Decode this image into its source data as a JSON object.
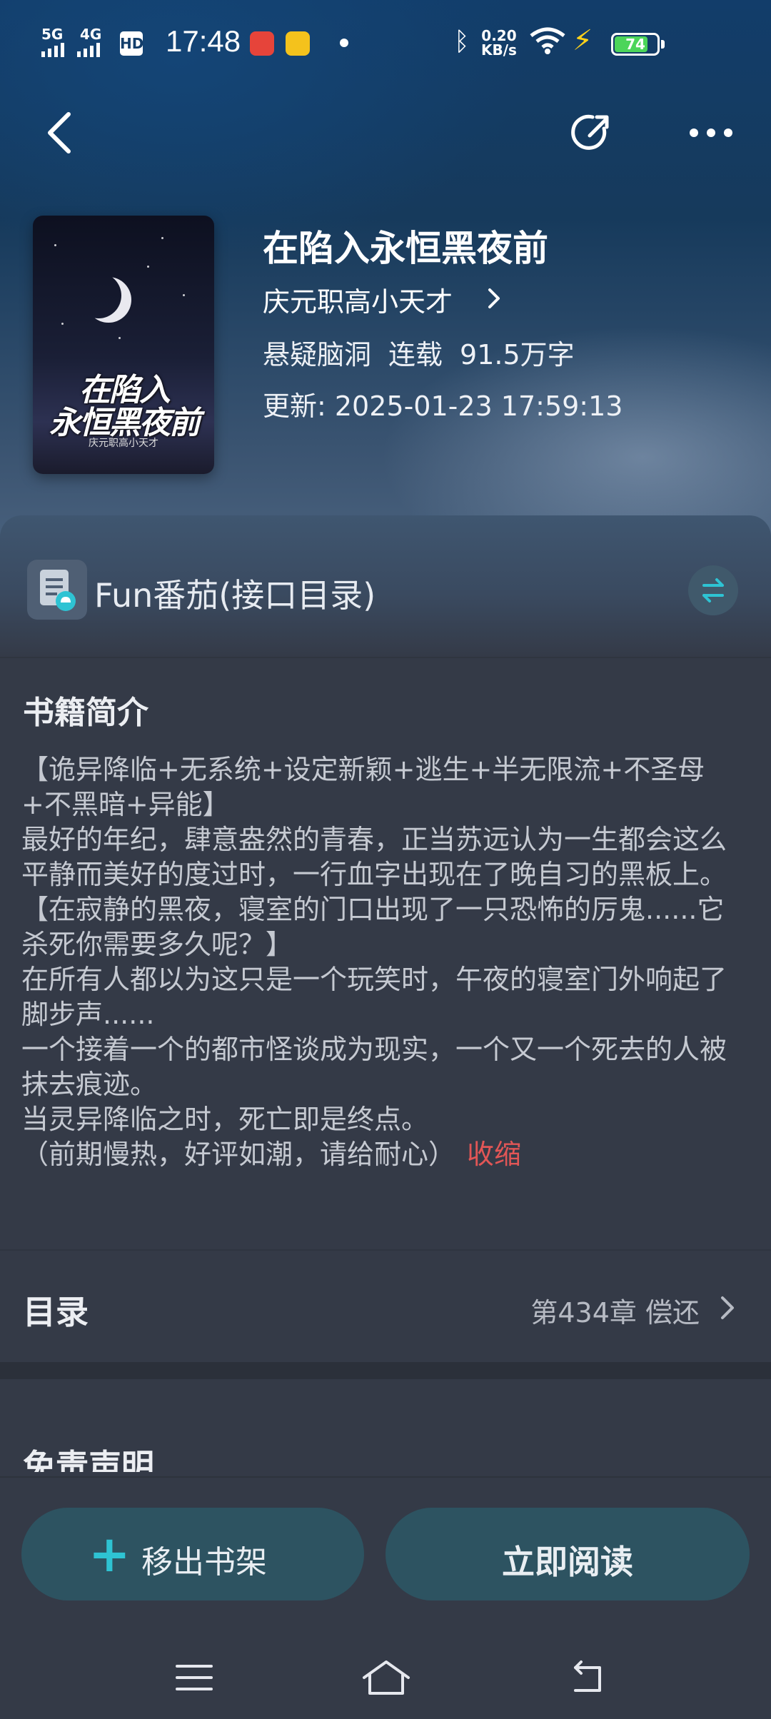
{
  "status_bar": {
    "signal1": "5G",
    "signal2": "4G",
    "hd": "HD",
    "time": "17:48",
    "net_speed_value": "0.20",
    "net_speed_unit": "KB/s",
    "battery": "74",
    "battery_level_percent": 74
  },
  "book": {
    "title": "在陷入永恒黑夜前",
    "author": "庆元职高小天才",
    "category": "悬疑脑洞",
    "status": "连载",
    "word_count": "91.5万字",
    "update": "更新: 2025-01-23 17:59:13",
    "cover_title_line1": "在陷入",
    "cover_title_line2": "永恒黑夜前",
    "cover_author": "庆元职高小天才"
  },
  "source": {
    "label": "Fun番茄(接口目录)"
  },
  "intro": {
    "heading": "书籍简介",
    "lines": [
      "【诡异降临+无系统+设定新颖+逃生+半无限流+不圣母+不黑暗+异能】",
      "最好的年纪，肆意盎然的青春，正当苏远认为一生都会这么平静而美好的度过时，一行血字出现在了晚自习的黑板上。",
      "【在寂静的黑夜，寝室的门口出现了一只恐怖的厉鬼......它杀死你需要多久呢？】",
      "在所有人都以为这只是一个玩笑时，午夜的寝室门外响起了脚步声......",
      "一个接着一个的都市怪谈成为现实，一个又一个死去的人被抹去痕迹。",
      "当灵异降临之时，死亡即是终点。",
      "（前期慢热，好评如潮，请给耐心）"
    ],
    "collapse": "收缩"
  },
  "toc": {
    "label": "目录",
    "latest": "第434章 偿还"
  },
  "disclaimer": {
    "heading": "免责声明"
  },
  "actions": {
    "remove": "移出书架",
    "read": "立即阅读"
  },
  "colors": {
    "accent": "#2ec3d3",
    "collapse": "#e25656",
    "button_bg": "#2d5361",
    "panel_bg": "#343a47"
  }
}
